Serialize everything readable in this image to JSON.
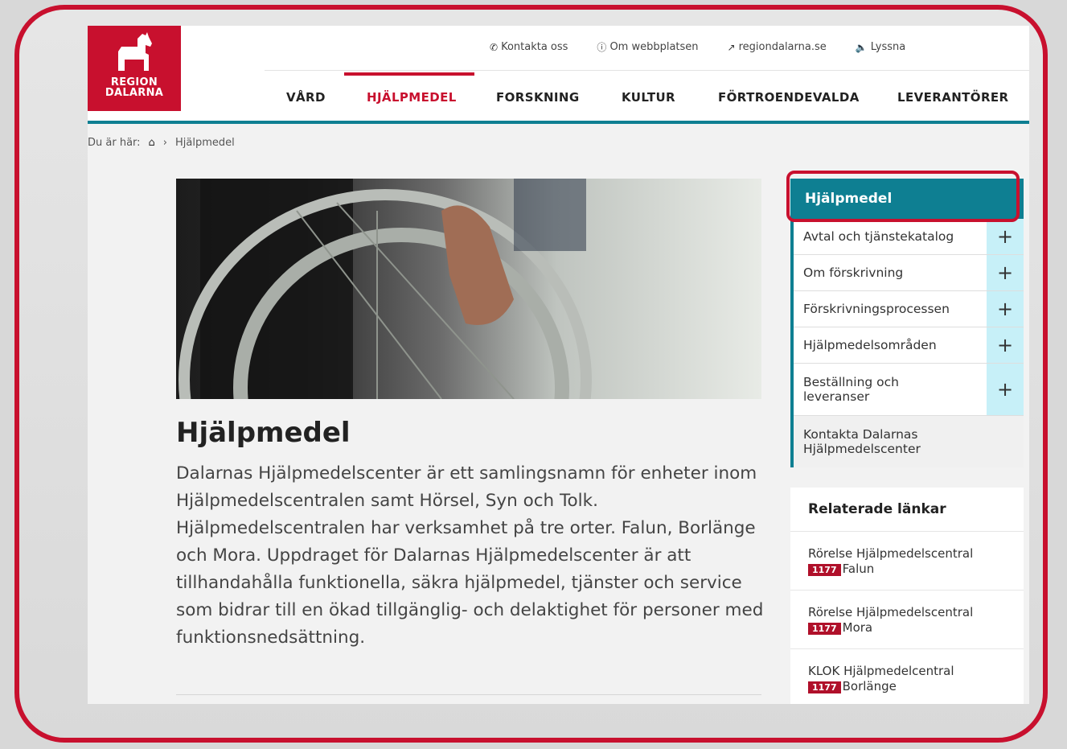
{
  "logo": {
    "line1": "REGION",
    "line2": "DALARNA"
  },
  "topnav": [
    {
      "icon": "phone-icon",
      "label": "Kontakta oss"
    },
    {
      "icon": "info-icon",
      "label": "Om webbplatsen"
    },
    {
      "icon": "external-link-icon",
      "label": "regiondalarna.se"
    },
    {
      "icon": "speaker-icon",
      "label": "Lyssna"
    }
  ],
  "mainnav": [
    "VÅRD",
    "HJÄLPMEDEL",
    "FORSKNING",
    "KULTUR",
    "FÖRTROENDEVALDA",
    "LEVERANTÖRER"
  ],
  "breadcrumb": {
    "prefix": "Du är här:",
    "separator": "›",
    "current": "Hjälpmedel"
  },
  "main": {
    "title": "Hjälpmedel",
    "lead": "Dalarnas Hjälpmedelscenter är ett samlingsnamn för enheter inom Hjälpmedelscentralen samt Hörsel, Syn och Tolk. Hjälpmedelscentralen har verksamhet på tre orter. Falun, Borlänge och Mora. Uppdraget för Dalarnas Hjälpmedelscenter är att tillhandahålla funktionella, säkra hjälpmedel, tjänster och service som bidrar till en ökad tillgänglig- och delaktighet för personer med funktionsnedsättning."
  },
  "side": {
    "title": "Hjälpmedel",
    "items": [
      {
        "label": "Avtal och tjänstekatalog",
        "plus": "+"
      },
      {
        "label": "Om förskrivning",
        "plus": "+"
      },
      {
        "label": "Förskrivningsprocessen",
        "plus": "+"
      },
      {
        "label": "Hjälpmedelsområden",
        "plus": "+"
      },
      {
        "label": "Beställning och leveranser",
        "plus": "+"
      },
      {
        "label": "Kontakta Dalarnas Hjälpmedelscenter"
      }
    ]
  },
  "related": {
    "title": "Relaterade länkar",
    "items": [
      {
        "text": "Rörelse Hjälpmedelscentral",
        "badge": "1177",
        "place": "Falun"
      },
      {
        "text": "Rörelse Hjälpmedelscentral",
        "badge": "1177",
        "place": "Mora"
      },
      {
        "text": "KLOK Hjälpmedelcentral",
        "badge": "1177",
        "place": "Borlänge"
      }
    ]
  },
  "colors": {
    "brand": "#c8102e",
    "teal": "#0e7f92",
    "plus_bg": "#c7f0f8"
  }
}
